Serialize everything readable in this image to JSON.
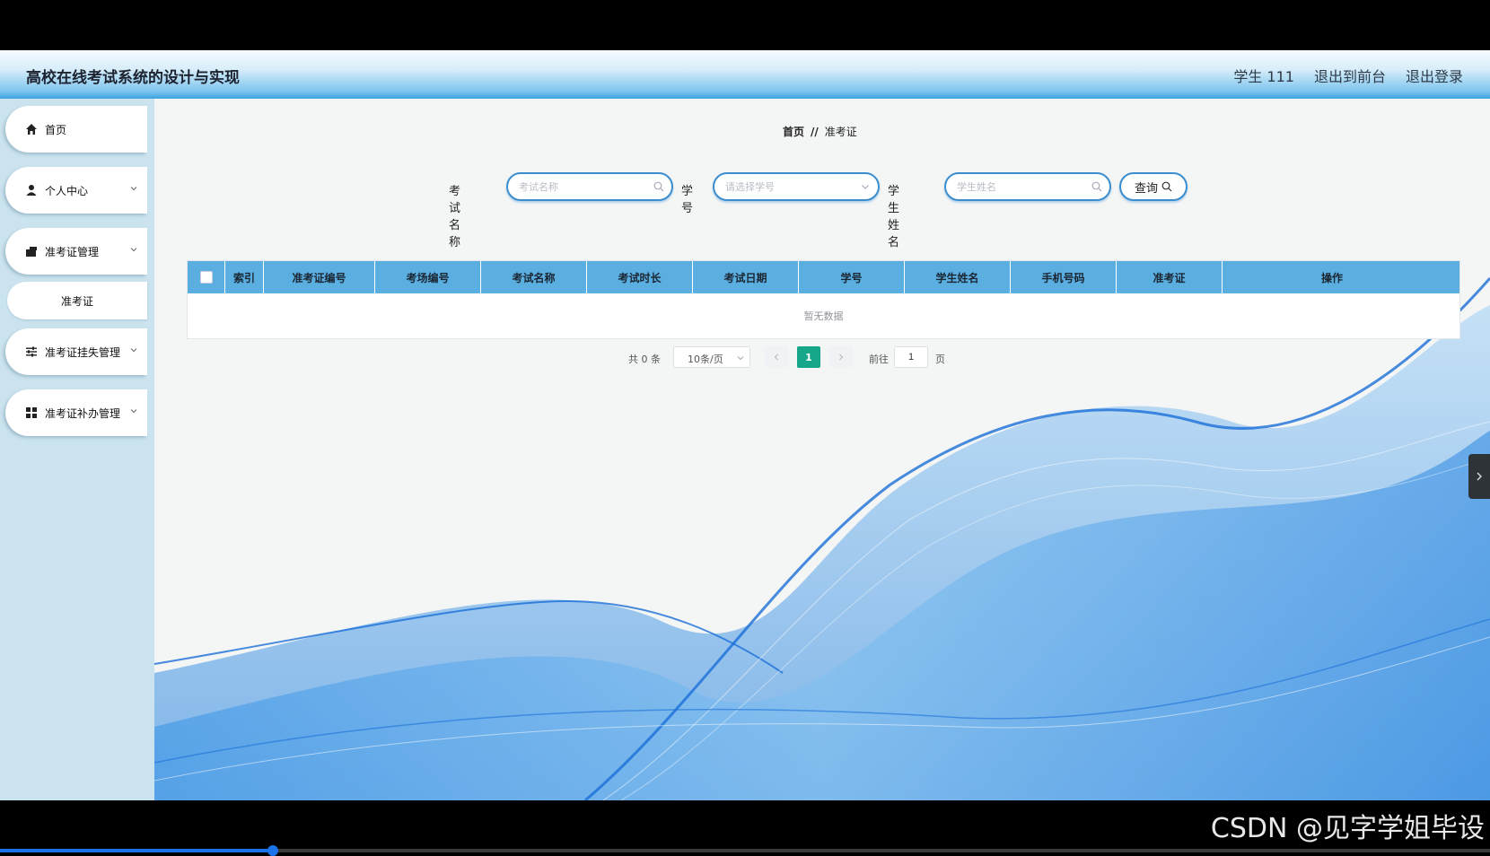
{
  "header": {
    "title": "高校在线考试系统的设计与实现",
    "user": "学生 111",
    "front_link": "退出到前台",
    "logout_link": "退出登录"
  },
  "sidebar": {
    "items": [
      {
        "label": "首页",
        "icon": "home-icon"
      },
      {
        "label": "个人中心",
        "icon": "user-icon"
      },
      {
        "label": "准考证管理",
        "icon": "ticket-icon"
      },
      {
        "label": "准考证挂失管理",
        "icon": "sliders-icon"
      },
      {
        "label": "准考证补办管理",
        "icon": "grid-icon"
      }
    ],
    "submenu": [
      "准考证"
    ]
  },
  "breadcrumb": {
    "home": "首页",
    "separator": "//",
    "current": "准考证"
  },
  "search": {
    "exam_name_label": "考试名称",
    "exam_name_placeholder": "考试名称",
    "student_no_label": "学号",
    "student_no_placeholder": "请选择学号",
    "student_name_label": "学生姓名",
    "student_name_placeholder": "学生姓名",
    "button_label": "查询"
  },
  "table": {
    "columns": [
      "索引",
      "准考证编号",
      "考场编号",
      "考试名称",
      "考试时长",
      "考试日期",
      "学号",
      "学生姓名",
      "手机号码",
      "准考证",
      "操作"
    ],
    "empty_text": "暂无数据",
    "header_color": "#5aaee0"
  },
  "pagination": {
    "total": "共 0 条",
    "page_size": "10条/页",
    "current_page": "1",
    "goto_label": "前往",
    "goto_value": "1",
    "page_suffix": "页",
    "accent_color": "#16a689"
  },
  "player": {
    "progress_percent": 18.3
  },
  "watermark": "CSDN @见字学姐毕设"
}
